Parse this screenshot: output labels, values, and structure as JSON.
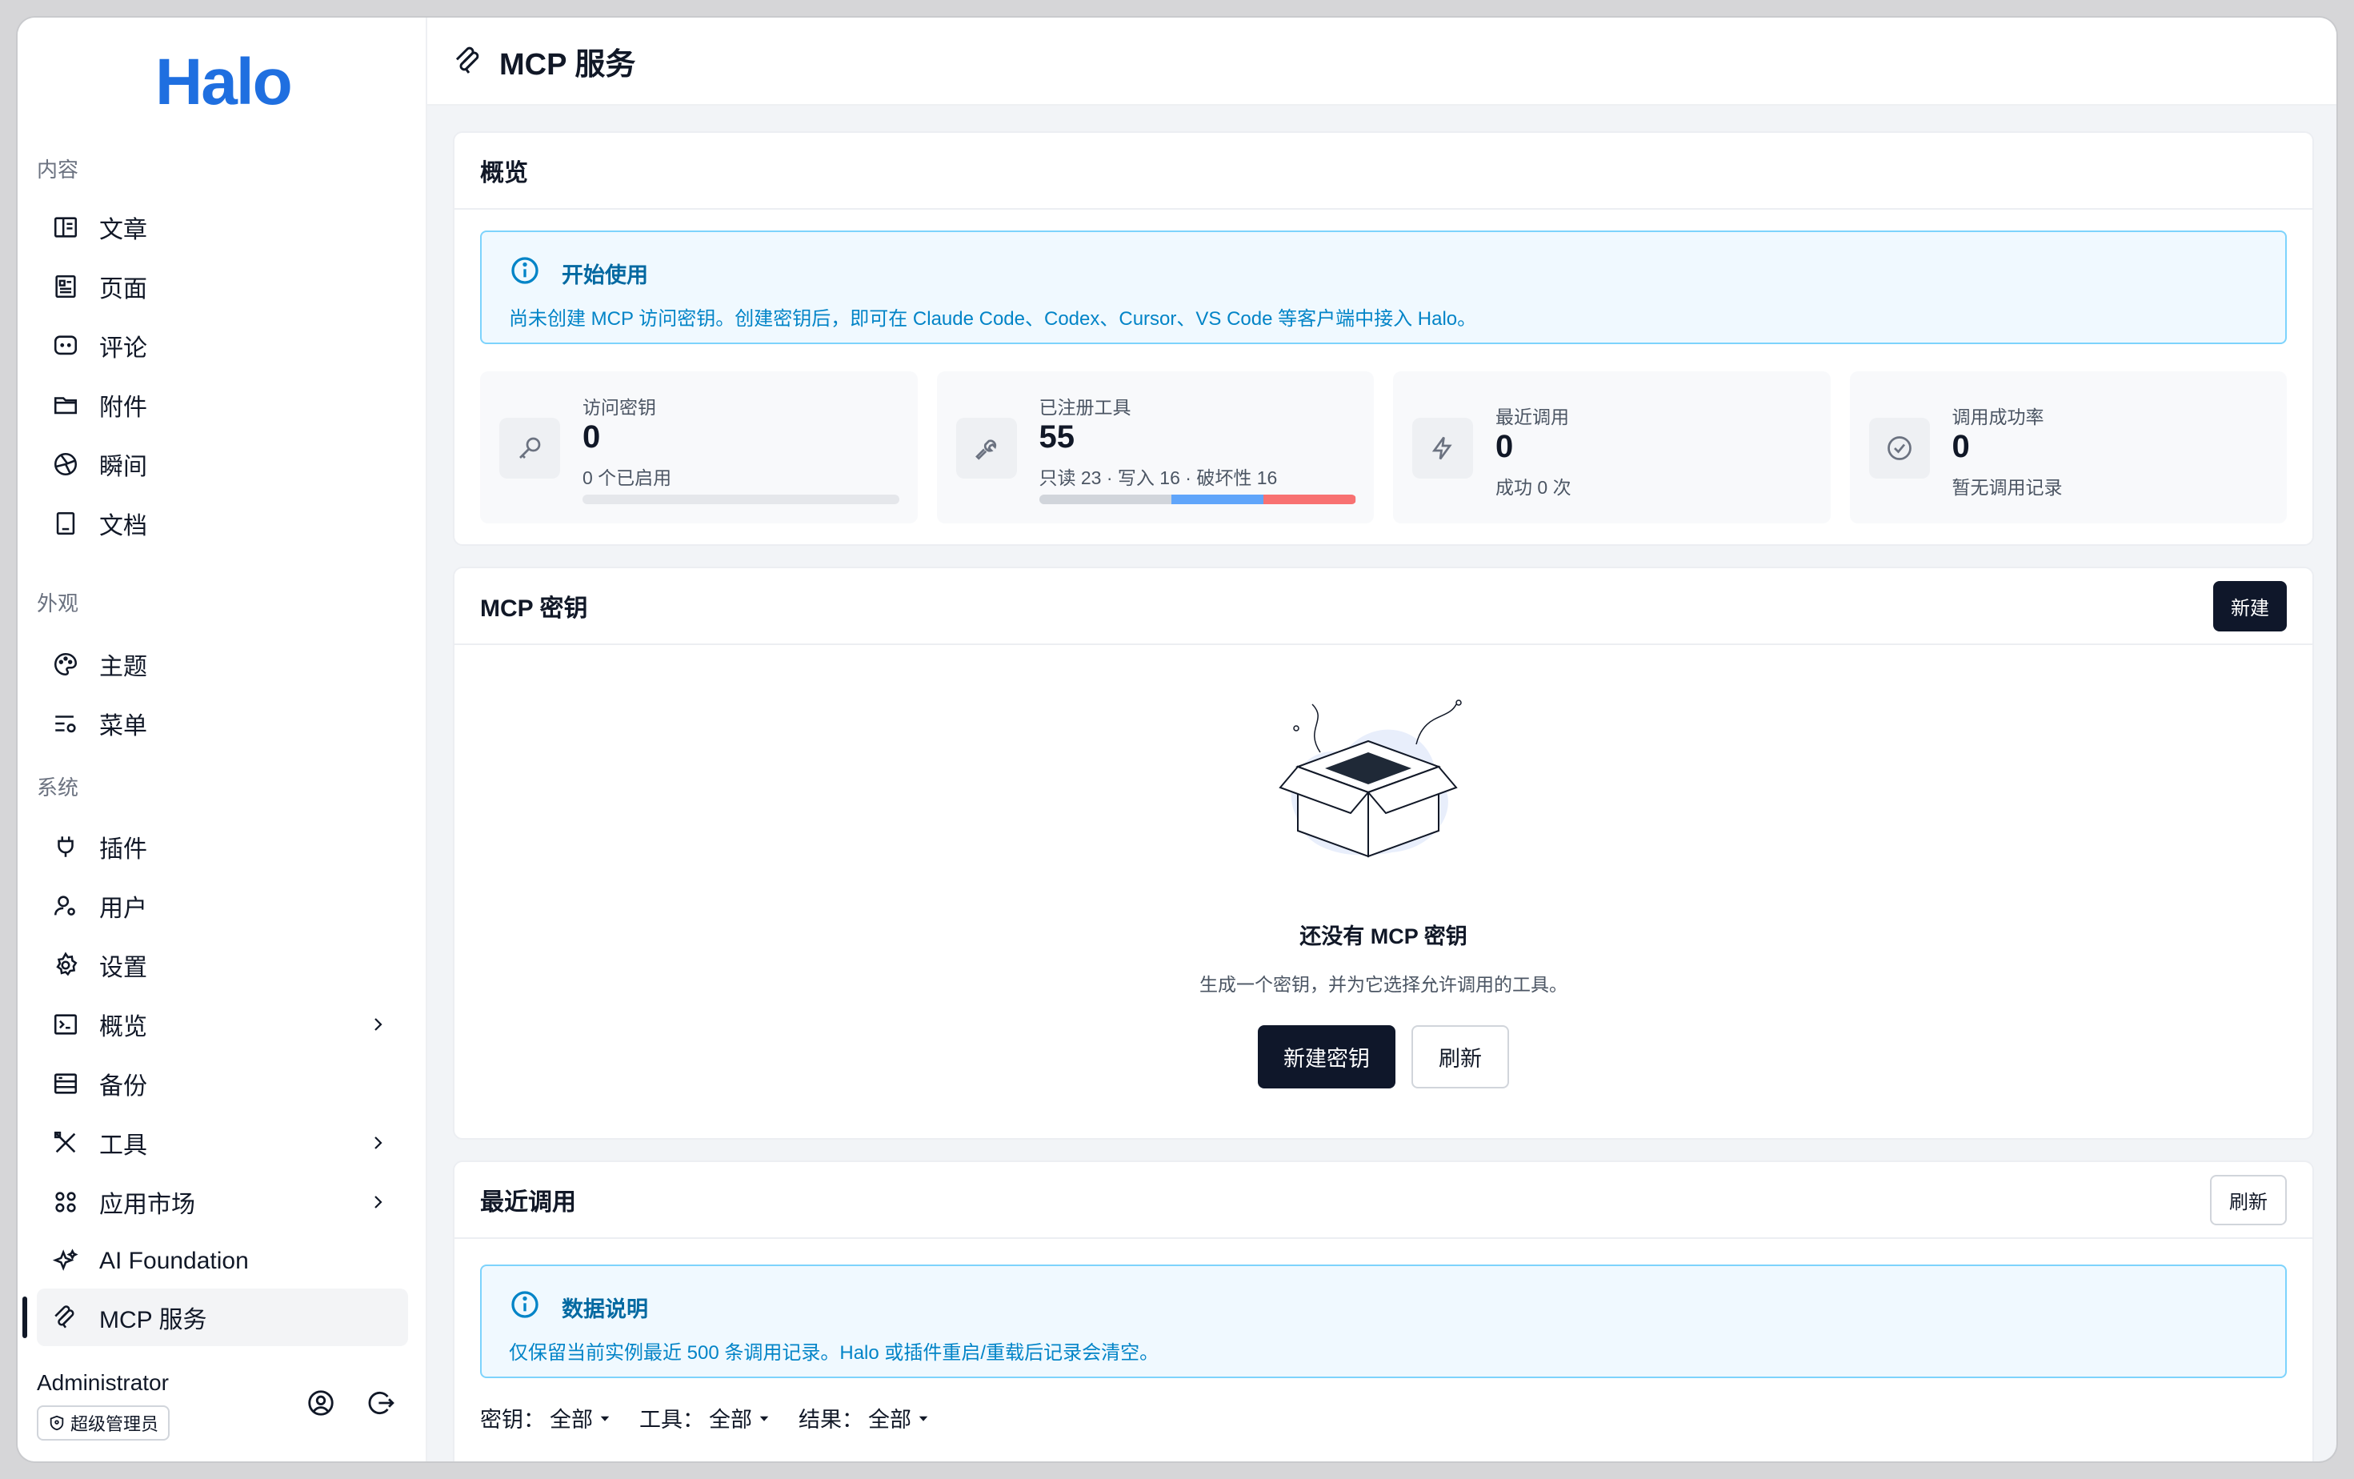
{
  "brand": "Halo",
  "sidebar": {
    "sections": [
      {
        "label": "内容"
      },
      {
        "label": "外观"
      },
      {
        "label": "系统"
      }
    ],
    "items": [
      {
        "label": "文章",
        "icon": "article-icon"
      },
      {
        "label": "页面",
        "icon": "page-icon"
      },
      {
        "label": "评论",
        "icon": "comment-icon"
      },
      {
        "label": "附件",
        "icon": "folder-icon"
      },
      {
        "label": "瞬间",
        "icon": "moment-icon"
      },
      {
        "label": "文档",
        "icon": "book-icon"
      },
      {
        "label": "主题",
        "icon": "palette-icon"
      },
      {
        "label": "菜单",
        "icon": "menu-settings-icon"
      },
      {
        "label": "插件",
        "icon": "plug-icon"
      },
      {
        "label": "用户",
        "icon": "user-gear-icon"
      },
      {
        "label": "设置",
        "icon": "gear-icon"
      },
      {
        "label": "概览",
        "icon": "terminal-icon"
      },
      {
        "label": "备份",
        "icon": "backup-icon"
      },
      {
        "label": "工具",
        "icon": "tools-icon"
      },
      {
        "label": "应用市场",
        "icon": "apps-icon"
      },
      {
        "label": "AI Foundation",
        "icon": "sparkle-icon"
      },
      {
        "label": "MCP 服务",
        "icon": "mcp-icon"
      }
    ],
    "user": {
      "name": "Administrator",
      "role": "超级管理员"
    }
  },
  "header": {
    "title": "MCP 服务"
  },
  "overview": {
    "title": "概览",
    "alert": {
      "title": "开始使用",
      "body": "尚未创建 MCP 访问密钥。创建密钥后，即可在 Claude Code、Codex、Cursor、VS Code 等客户端中接入 Halo。"
    },
    "stats": [
      {
        "label": "访问密钥",
        "value": "0",
        "sub": "0 个已启用"
      },
      {
        "label": "已注册工具",
        "value": "55",
        "sub": "只读 23 · 写入 16 · 破坏性 16"
      },
      {
        "label": "最近调用",
        "value": "0",
        "sub": "成功 0 次"
      },
      {
        "label": "调用成功率",
        "value": "0",
        "sub": "暂无调用记录"
      }
    ],
    "tool_breakdown": {
      "readonly": 23,
      "write": 16,
      "destructive": 16,
      "total": 55
    },
    "colors": {
      "readonly": "#d1d5db",
      "write": "#60a5fa",
      "destructive": "#f87171"
    }
  },
  "keys": {
    "title": "MCP 密钥",
    "new_label": "新建",
    "empty_title": "还没有 MCP 密钥",
    "empty_desc": "生成一个密钥，并为它选择允许调用的工具。",
    "create_label": "新建密钥",
    "refresh_label": "刷新"
  },
  "recent": {
    "title": "最近调用",
    "refresh_label": "刷新",
    "alert": {
      "title": "数据说明",
      "body": "仅保留当前实例最近 500 条调用记录。Halo 或插件重启/重载后记录会清空。"
    },
    "filters": [
      {
        "label": "密钥：",
        "value": "全部"
      },
      {
        "label": "工具：",
        "value": "全部"
      },
      {
        "label": "结果：",
        "value": "全部"
      }
    ]
  }
}
